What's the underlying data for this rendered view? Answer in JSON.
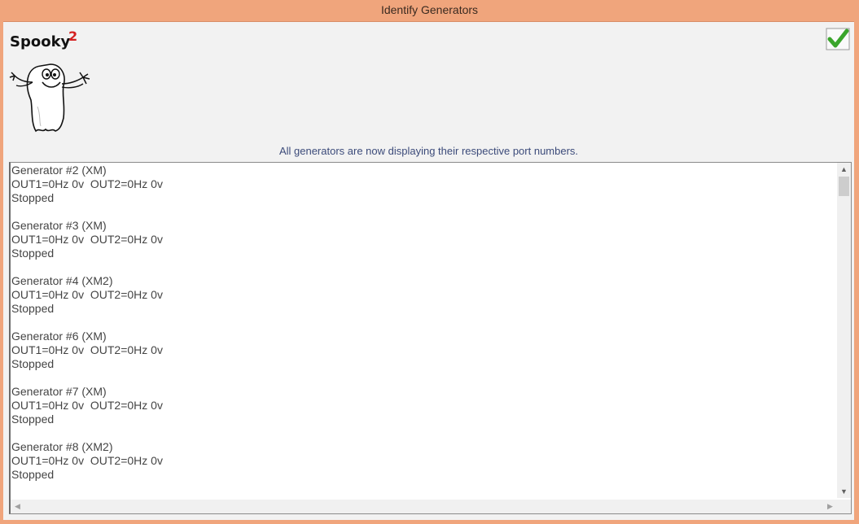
{
  "window": {
    "title": "Identify Generators"
  },
  "logo": {
    "text": "Spooky",
    "superscript": "2"
  },
  "ok_button": {
    "icon": "green-check-icon",
    "color": "#3aa52b"
  },
  "status_text": "All generators are now displaying their respective port numbers.",
  "generators": [
    {
      "name": "Generator #2 (XM)",
      "outputs": "OUT1=0Hz 0v  OUT2=0Hz 0v",
      "state": "Stopped"
    },
    {
      "name": "Generator #3 (XM)",
      "outputs": "OUT1=0Hz 0v  OUT2=0Hz 0v",
      "state": "Stopped"
    },
    {
      "name": "Generator #4 (XM2)",
      "outputs": "OUT1=0Hz 0v  OUT2=0Hz 0v",
      "state": "Stopped"
    },
    {
      "name": "Generator #6 (XM)",
      "outputs": "OUT1=0Hz 0v  OUT2=0Hz 0v",
      "state": "Stopped"
    },
    {
      "name": "Generator #7 (XM)",
      "outputs": "OUT1=0Hz 0v  OUT2=0Hz 0v",
      "state": "Stopped"
    },
    {
      "name": "Generator #8 (XM2)",
      "outputs": "OUT1=0Hz 0v  OUT2=0Hz 0v",
      "state": "Stopped"
    }
  ]
}
